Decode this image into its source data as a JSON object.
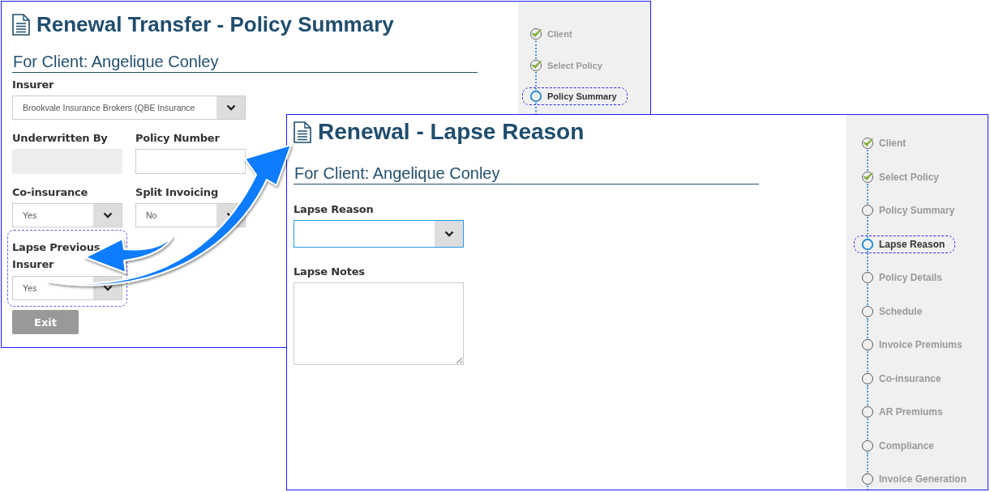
{
  "windows": [
    {
      "title": "Renewal Transfer - Policy Summary",
      "subtitle": "For Client: Angelique Conley",
      "form_rows": [
        [
          {
            "kind": "select",
            "label": "Insurer",
            "value": "Brookvale Insurance Brokers (QBE Insurance",
            "focused": false,
            "highlighted": false
          }
        ],
        [
          {
            "kind": "readonly",
            "label": "Underwritten By",
            "focused": false,
            "highlighted": false
          },
          {
            "kind": "text",
            "label": "Policy Number",
            "focused": false,
            "highlighted": false
          }
        ],
        [
          {
            "kind": "select",
            "label": "Co-insurance",
            "value": "Yes",
            "focused": false,
            "highlighted": false
          },
          {
            "kind": "select",
            "label": "Split Invoicing",
            "value": "No",
            "focused": false,
            "highlighted": false
          }
        ],
        [
          {
            "kind": "select",
            "label": "Lapse Previous Insurer",
            "value": "Yes",
            "focused": false,
            "highlighted": true
          }
        ]
      ],
      "buttons": [
        {
          "label": "Exit"
        }
      ],
      "steps": [
        {
          "label": "Client",
          "checked": true,
          "selected": false
        },
        {
          "label": "Select Policy",
          "checked": true,
          "selected": false
        },
        {
          "label": "Policy Summary",
          "checked": false,
          "selected": true
        }
      ]
    },
    {
      "title": "Renewal - Lapse Reason",
      "subtitle": "For Client: Angelique Conley",
      "form_rows": [
        [
          {
            "kind": "select",
            "label": "Lapse Reason",
            "focused": true,
            "highlighted": false
          }
        ],
        [
          {
            "kind": "textarea",
            "label": "Lapse Notes",
            "focused": false,
            "highlighted": false
          }
        ]
      ],
      "steps": [
        {
          "label": "Client",
          "checked": true,
          "selected": false
        },
        {
          "label": "Select Policy",
          "checked": true,
          "selected": false
        },
        {
          "label": "Policy Summary",
          "checked": false,
          "selected": false
        },
        {
          "label": "Lapse Reason",
          "checked": false,
          "selected": true
        },
        {
          "label": "Policy Details",
          "checked": false,
          "selected": false
        },
        {
          "label": "Schedule",
          "checked": false,
          "selected": false
        },
        {
          "label": "Invoice Premiums",
          "checked": false,
          "selected": false
        },
        {
          "label": "Co-insurance",
          "checked": false,
          "selected": false
        },
        {
          "label": "AR Premiums",
          "checked": false,
          "selected": false
        },
        {
          "label": "Compliance",
          "checked": false,
          "selected": false
        },
        {
          "label": "Invoice Generation",
          "checked": false,
          "selected": false
        }
      ]
    }
  ]
}
